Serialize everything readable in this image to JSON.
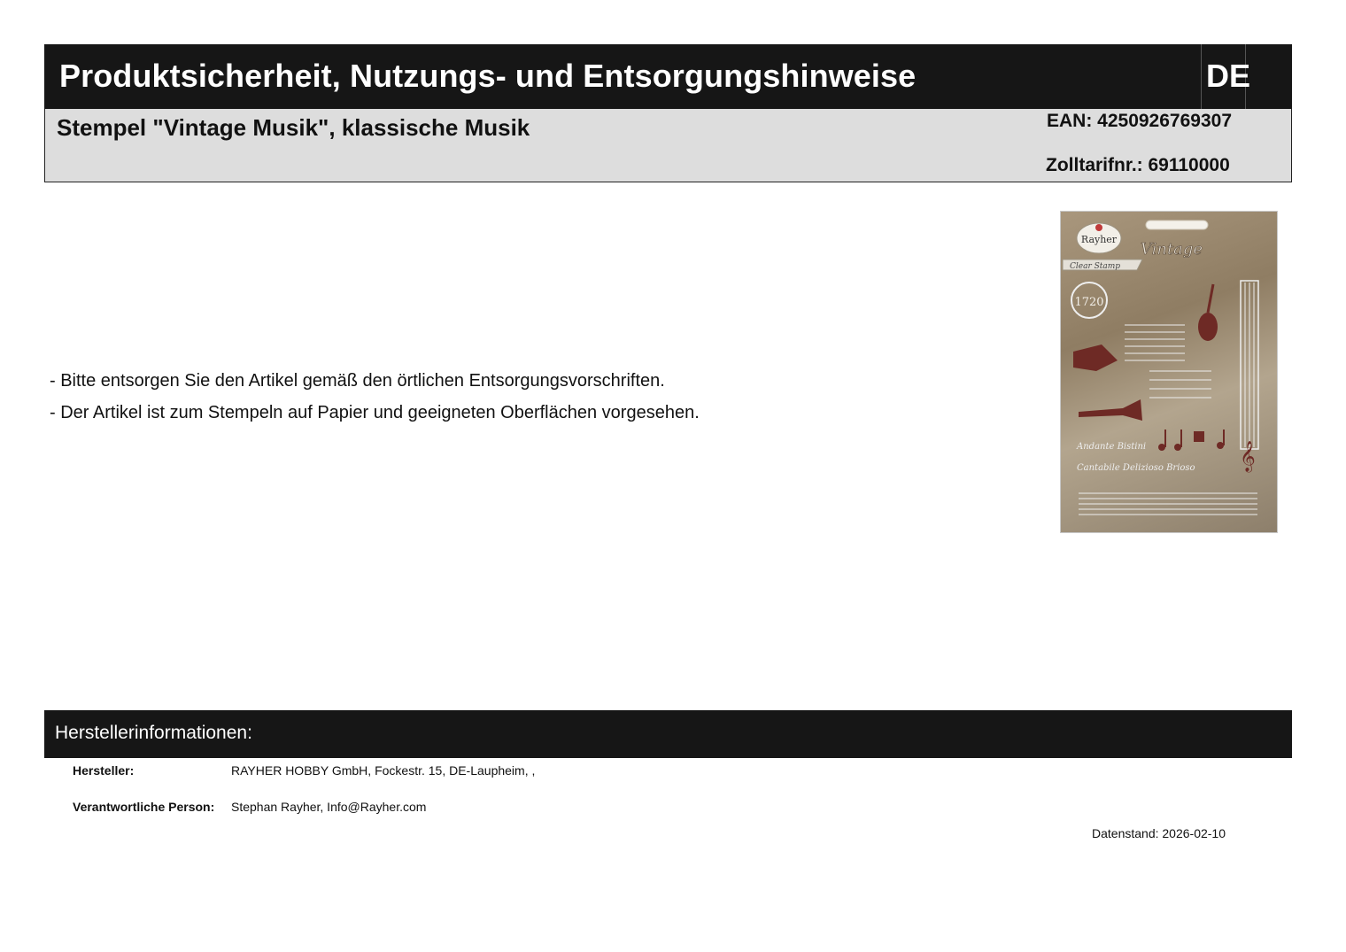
{
  "header": {
    "title": "Produktsicherheit, Nutzungs- und Entsorgungshinweise",
    "language": "DE"
  },
  "product": {
    "name": "Stempel \"Vintage Musik\", klassische Musik",
    "ean": "EAN: 4250926769307",
    "customs": "Zolltarifnr.: 69110000"
  },
  "notes": [
    "- Bitte entsorgen Sie den Artikel gemäß den örtlichen Entsorgungsvorschriften.",
    "- Der Artikel ist zum Stempeln auf Papier und geeigneten Oberflächen vorgesehen."
  ],
  "product_image": {
    "brand": "Rayher",
    "label": "Clear Stamp",
    "logo_text": "Vintage",
    "year": "1720",
    "script_line_1": "Andante Bistini",
    "script_line_2": "Cantabile Delizioso Brioso"
  },
  "manufacturer": {
    "section_title": "Herstellerinformationen:",
    "maker_label": "Hersteller:",
    "maker_value": "RAYHER HOBBY GmbH, Fockestr. 15,  DE-Laupheim, ,",
    "person_label": "Verantwortliche Person:",
    "person_value": "Stephan Rayher, Info@Rayher.com"
  },
  "footer": {
    "date": "Datenstand: 2026-02-10"
  },
  "colors": {
    "header_bg": "#161616",
    "product_bar_bg": "#dddddd"
  }
}
